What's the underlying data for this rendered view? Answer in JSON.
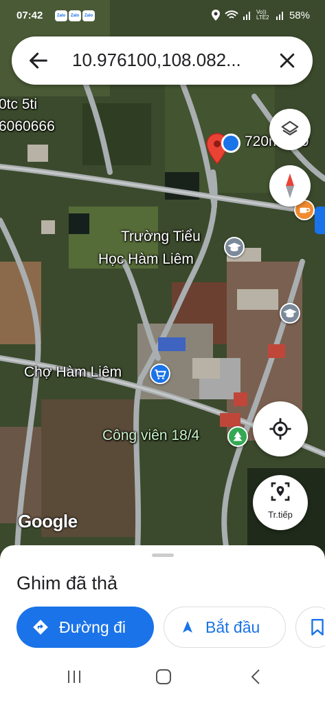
{
  "status_bar": {
    "time": "07:42",
    "notifications": [
      "Zalo",
      "Zalo",
      "Zalo"
    ],
    "battery": "58%",
    "network_label": "Vo)) LTE2"
  },
  "search": {
    "query": "10.976100,108.082..."
  },
  "map": {
    "labels": {
      "partial_top_left_1": "0tc 5ti",
      "partial_top_left_2": "6060666",
      "partial_top_right": "720m / 30",
      "school": "Trường Tiểu\nHọc Hàm Liêm",
      "school_line1": "Trường Tiểu",
      "school_line2": "Học Hàm Liêm",
      "market": "Chợ Hàm Liêm",
      "park": "Công viên 18/4",
      "google": "Google"
    },
    "icons": [
      "layers-icon",
      "compass-icon",
      "my-location-icon",
      "street-view-icon"
    ]
  },
  "fab": {
    "street_view_label": "Tr.tiếp"
  },
  "sheet": {
    "title": "Ghim đã thả",
    "directions_label": "Đường đi",
    "start_label": "Bắt đầu"
  },
  "colors": {
    "accent": "#1a73e8",
    "pin": "#ea4335",
    "school_poi": "#7b8a9a",
    "market_poi": "#1a73e8",
    "park_poi": "#34a853",
    "cafe_poi": "#f28b30"
  }
}
